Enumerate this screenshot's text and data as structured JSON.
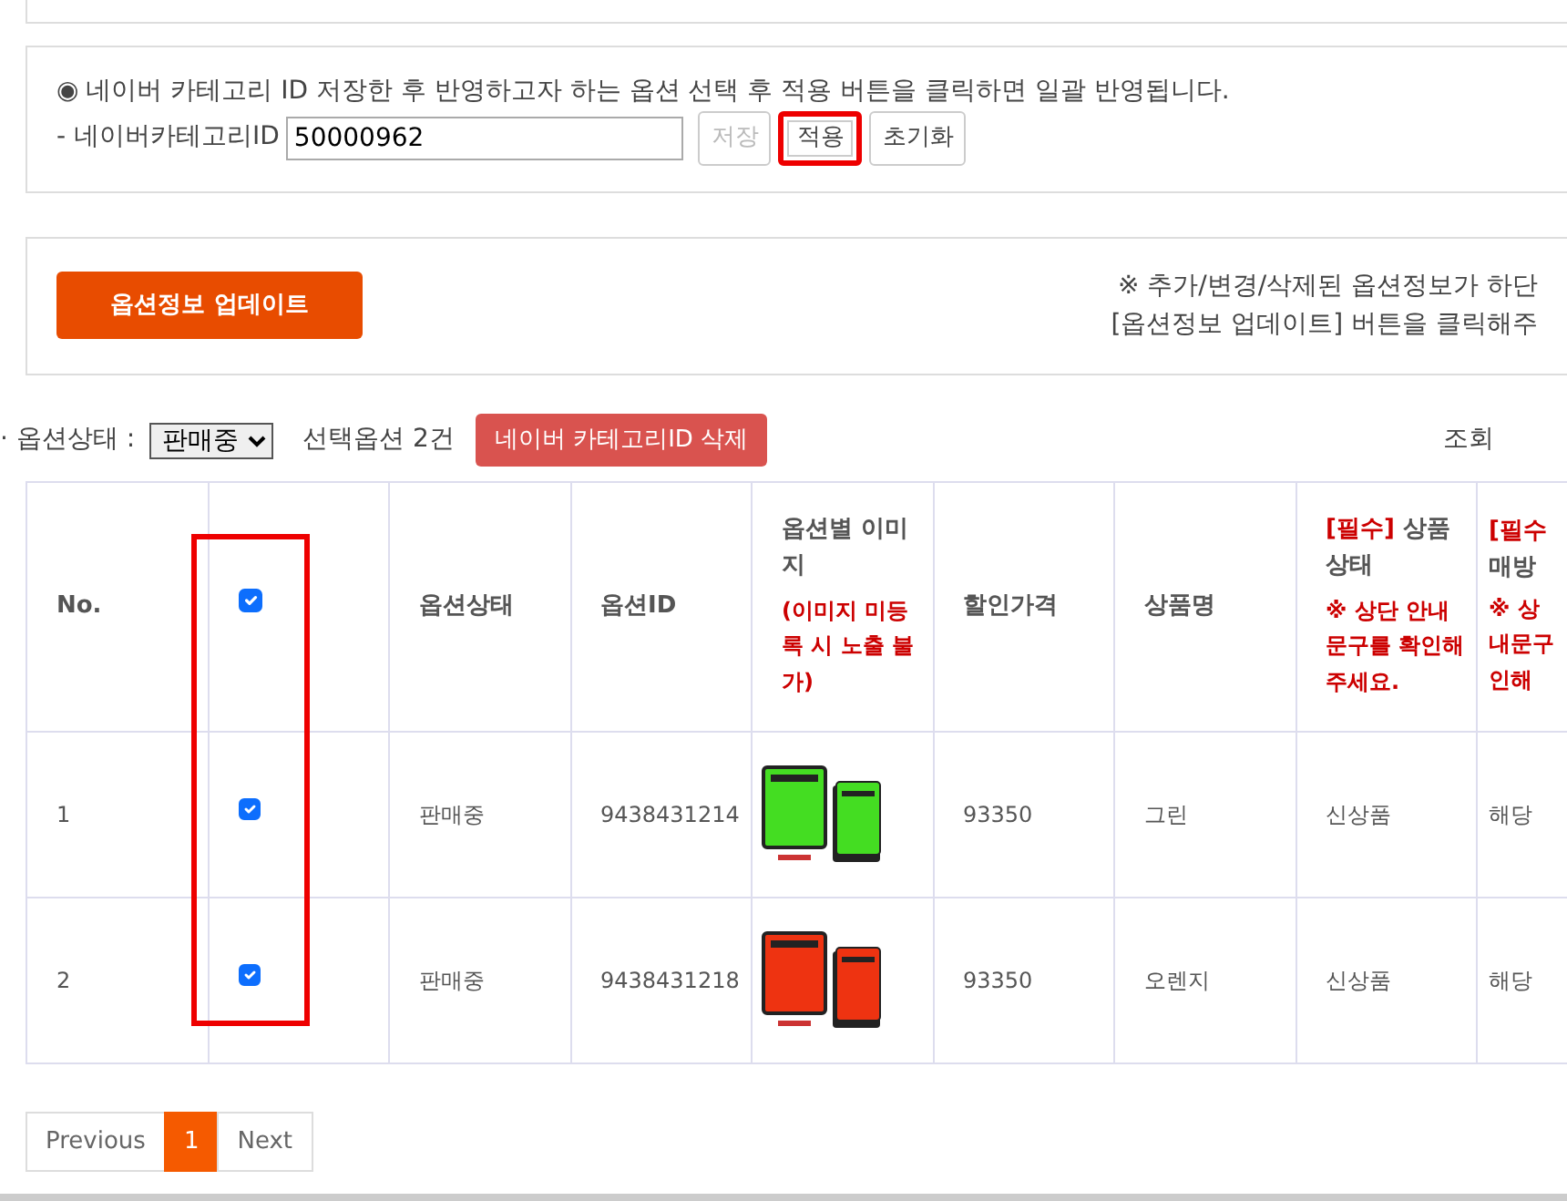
{
  "category_panel": {
    "notice_icon": "◉",
    "notice": "네이버 카테고리 ID 저장한 후 반영하고자 하는 옵션 선택 후 적용 버튼을 클릭하면 일괄 반영됩니다.",
    "field_label": "- 네이버카테고리ID",
    "field_value": "50000962",
    "buttons": [
      {
        "label": "저장",
        "disabled": true,
        "highlighted": false
      },
      {
        "label": "적용",
        "disabled": false,
        "highlighted": true
      },
      {
        "label": "초기화",
        "disabled": false,
        "highlighted": false
      }
    ]
  },
  "update_panel": {
    "button": "옵션정보 업데이트",
    "notes": [
      "※ 추가/변경/삭제된 옵션정보가 하단",
      "[옵션정보 업데이트] 버튼을 클릭해주"
    ]
  },
  "filter_bar": {
    "status_label": "· 옵션상태 :",
    "status_value": "판매중",
    "selected_count": "선택옵션 2건",
    "delete_button": "네이버 카테고리ID 삭제",
    "right_text": "조회"
  },
  "table": {
    "checkbox_column_highlighted": true,
    "header_checked": true,
    "columns": [
      {
        "kind": "plain",
        "title": "No."
      },
      {
        "kind": "checkbox"
      },
      {
        "kind": "plain",
        "title": "옵션상태"
      },
      {
        "kind": "plain",
        "title": "옵션ID"
      },
      {
        "kind": "noted",
        "title": "옵션별 이미지",
        "note": "(이미지 미등록 시 노출 불가)"
      },
      {
        "kind": "plain",
        "title": "할인가격"
      },
      {
        "kind": "plain",
        "title": "상품명"
      },
      {
        "kind": "required",
        "required": "[필수]",
        "title": "상품상태",
        "note": "※ 상단 안내문구를 확인해주세요."
      },
      {
        "kind": "cut",
        "required": "[필수",
        "title": "매방",
        "note_lines": [
          "※ 상",
          "내문구",
          "인해"
        ]
      }
    ],
    "rows": [
      {
        "no": "1",
        "checked": true,
        "status": "판매중",
        "option_id": "9438431214",
        "color": "#44dd22",
        "price": "93350",
        "name": "그린",
        "condition": "신상품",
        "column_9": "해당"
      },
      {
        "no": "2",
        "checked": true,
        "status": "판매중",
        "option_id": "9438431218",
        "color": "#ee3311",
        "price": "93350",
        "name": "오렌지",
        "condition": "신상품",
        "column_9": "해당"
      }
    ]
  },
  "pagination": [
    {
      "label": "Previous",
      "selected": false
    },
    {
      "label": "1",
      "selected": true
    },
    {
      "label": "Next",
      "selected": false
    }
  ]
}
